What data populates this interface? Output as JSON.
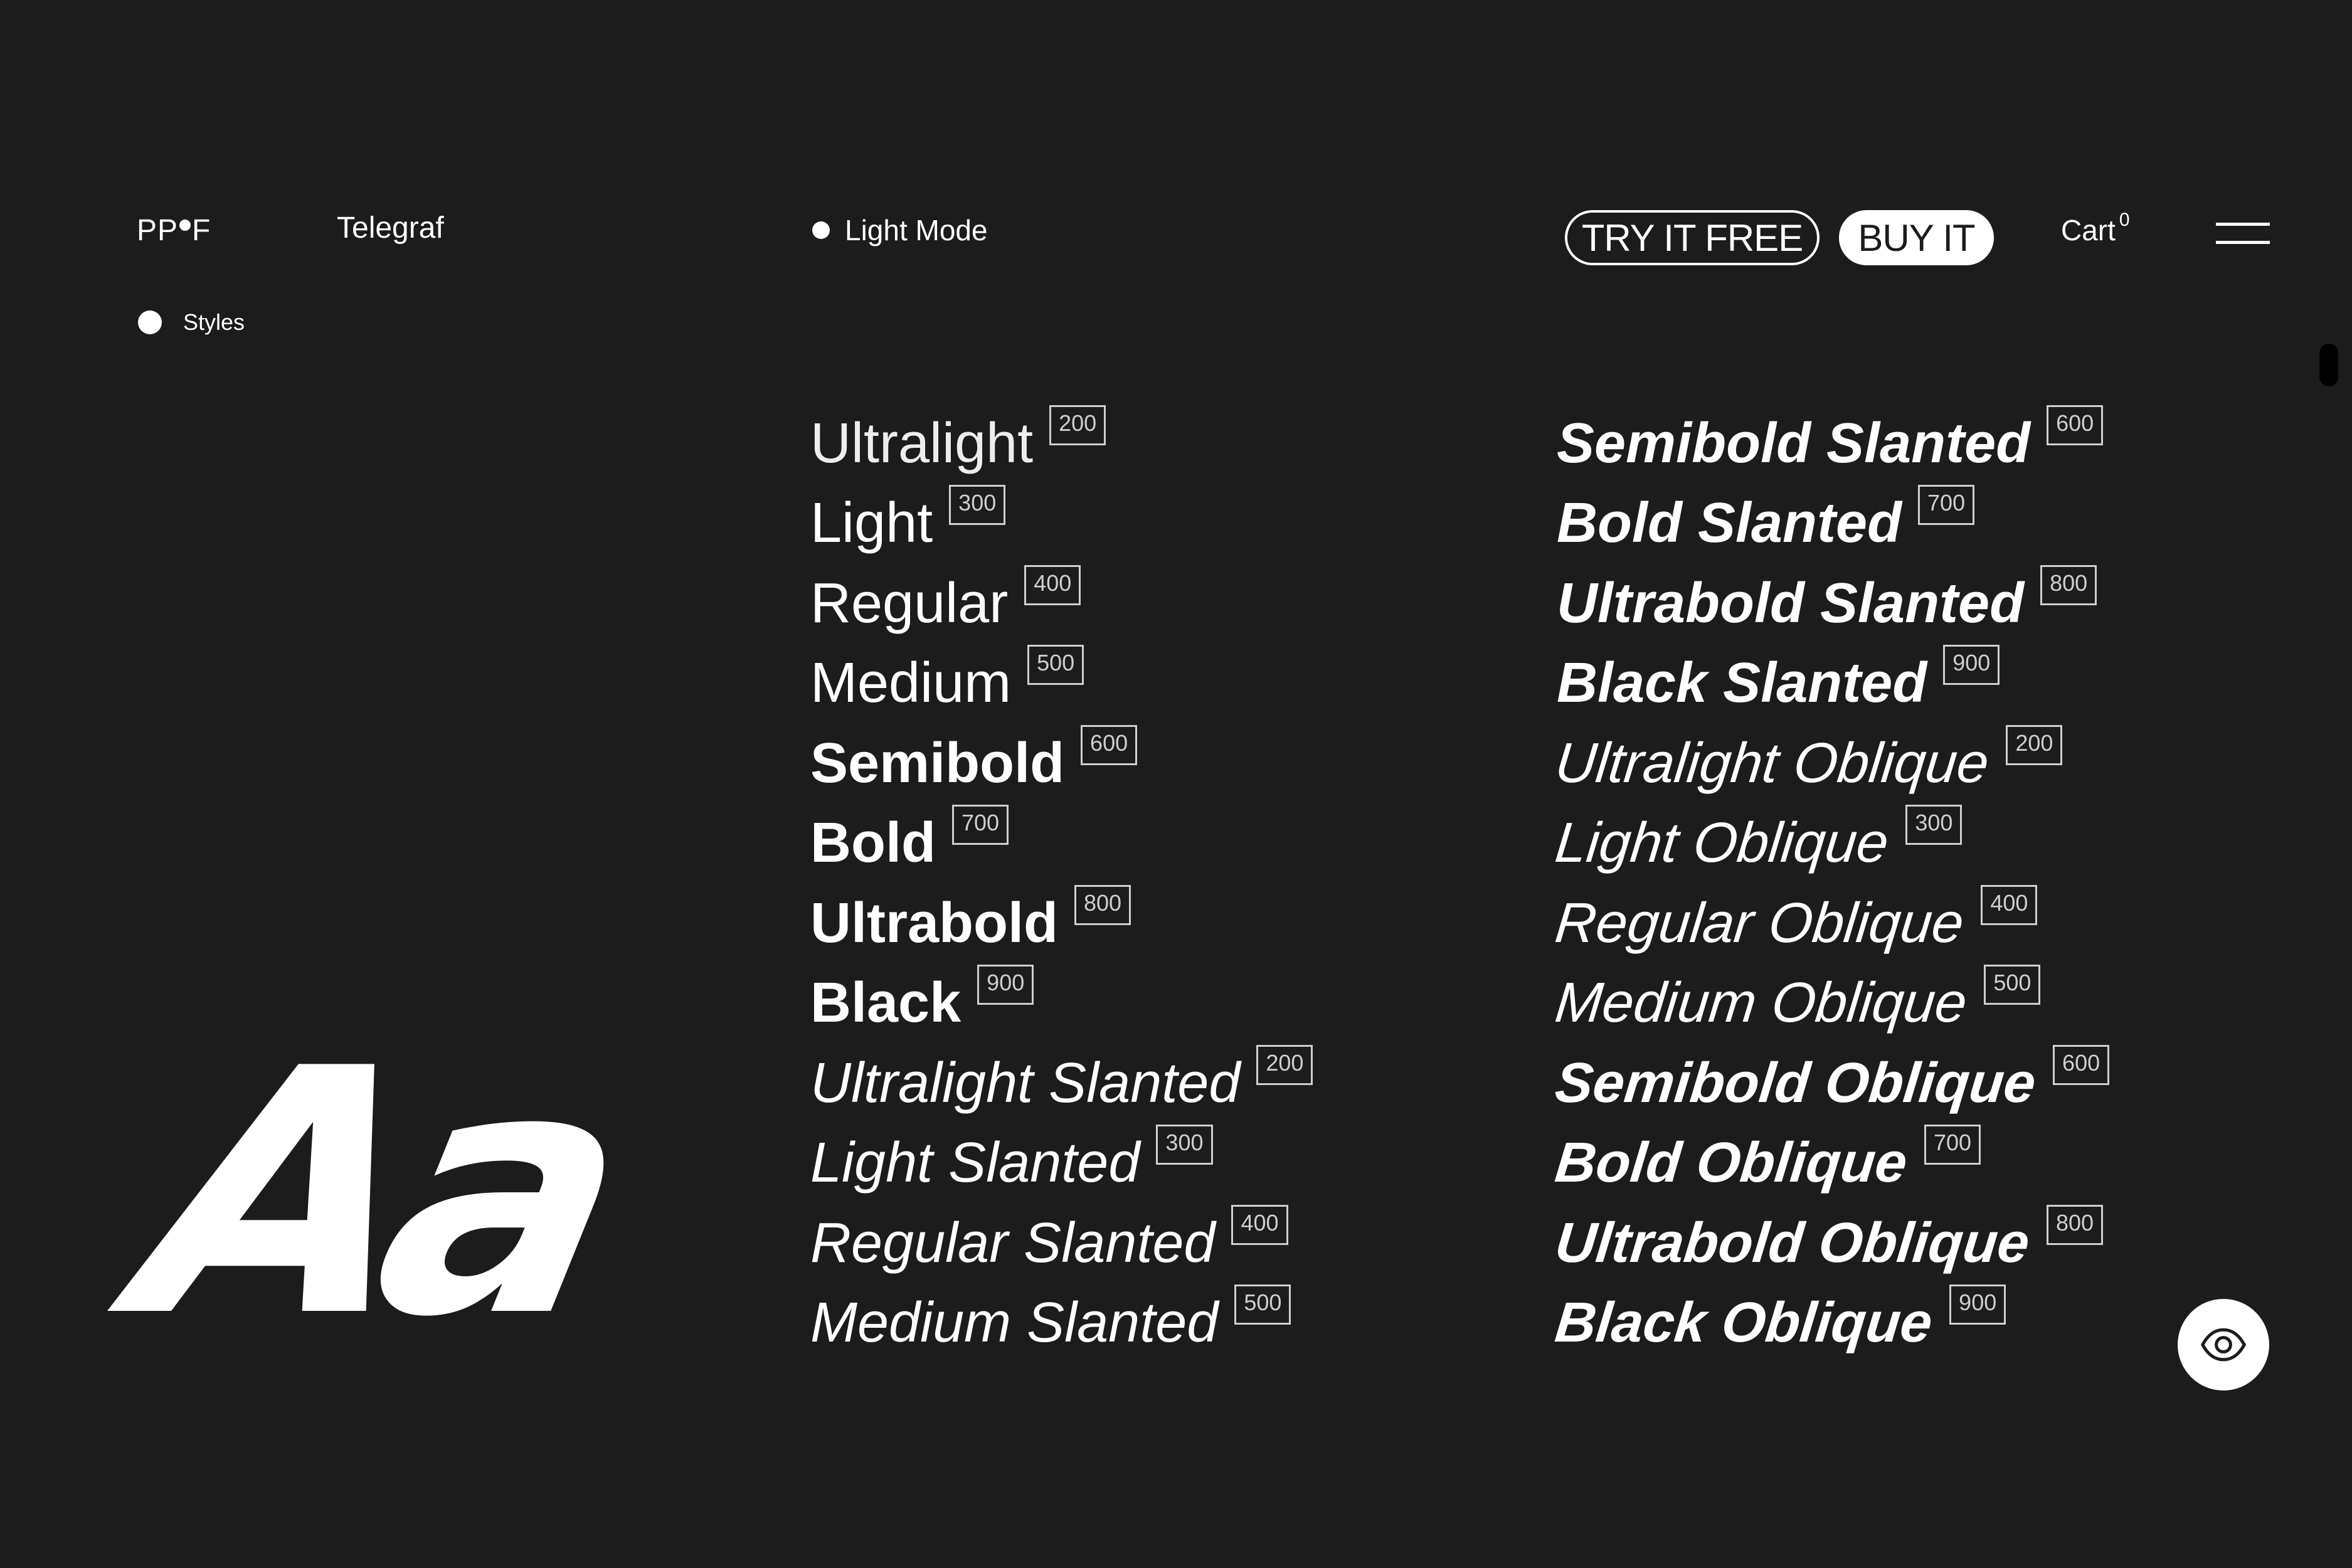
{
  "header": {
    "logo_left": "PP",
    "logo_right": "F",
    "typeface": "Telegraf",
    "mode_label": "Light Mode",
    "try_label": "TRY IT FREE",
    "buy_label": "BUY IT",
    "cart_label": "Cart",
    "cart_count": "0"
  },
  "sidebar": {
    "styles_label": "Styles"
  },
  "specimen": {
    "glyphs": "Aa"
  },
  "styles": {
    "left": [
      {
        "name": "Ultralight",
        "weight": "200"
      },
      {
        "name": "Light",
        "weight": "300"
      },
      {
        "name": "Regular",
        "weight": "400"
      },
      {
        "name": "Medium",
        "weight": "500"
      },
      {
        "name": "Semibold",
        "weight": "600"
      },
      {
        "name": "Bold",
        "weight": "700"
      },
      {
        "name": "Ultrabold",
        "weight": "800"
      },
      {
        "name": "Black",
        "weight": "900"
      },
      {
        "name": "Ultralight Slanted",
        "weight": "200"
      },
      {
        "name": "Light Slanted",
        "weight": "300"
      },
      {
        "name": "Regular Slanted",
        "weight": "400"
      },
      {
        "name": "Medium Slanted",
        "weight": "500"
      }
    ],
    "right": [
      {
        "name": "Semibold Slanted",
        "weight": "600"
      },
      {
        "name": "Bold Slanted",
        "weight": "700"
      },
      {
        "name": "Ultrabold Slanted",
        "weight": "800"
      },
      {
        "name": "Black Slanted",
        "weight": "900"
      },
      {
        "name": "Ultralight Oblique",
        "weight": "200"
      },
      {
        "name": "Light Oblique",
        "weight": "300"
      },
      {
        "name": "Regular Oblique",
        "weight": "400"
      },
      {
        "name": "Medium Oblique",
        "weight": "500"
      },
      {
        "name": "Semibold Oblique",
        "weight": "600"
      },
      {
        "name": "Bold Oblique",
        "weight": "700"
      },
      {
        "name": "Ultrabold Oblique",
        "weight": "800"
      },
      {
        "name": "Black Oblique",
        "weight": "900"
      }
    ]
  },
  "icons": {
    "preview": "eye-icon",
    "menu": "menu-icon"
  },
  "colors": {
    "background": "#1c1c1c",
    "foreground": "#ffffff",
    "tag": "#cfcfcf"
  }
}
